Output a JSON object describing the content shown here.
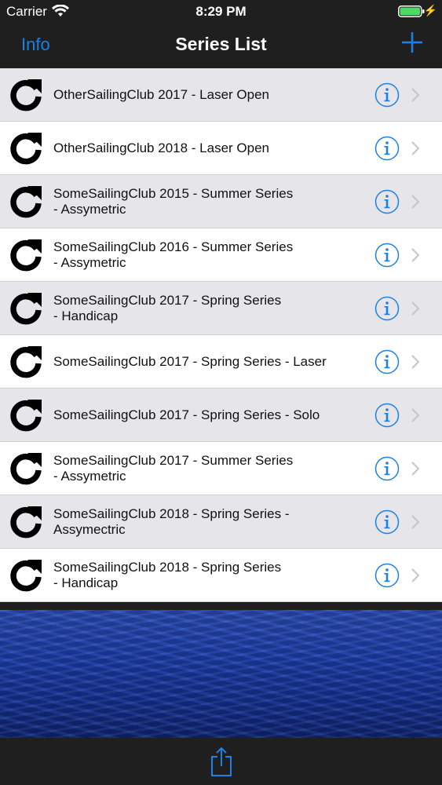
{
  "status": {
    "carrier": "Carrier",
    "time": "8:29 PM"
  },
  "nav": {
    "left_label": "Info",
    "title": "Series List",
    "right_icon": "plus-icon"
  },
  "colors": {
    "accent": "#1a82e6",
    "bar": "#1f1f1f",
    "row_alt": "#e5e5ea",
    "battery": "#4cd964"
  },
  "rows": [
    {
      "line1": "OtherSailingClub 2017 - Laser Open",
      "line2": ""
    },
    {
      "line1": "OtherSailingClub 2018 - Laser Open",
      "line2": ""
    },
    {
      "line1": "SomeSailingClub 2015 - Summer Series",
      "line2": "- Assymetric"
    },
    {
      "line1": "SomeSailingClub 2016 - Summer Series",
      "line2": "- Assymetric"
    },
    {
      "line1": "SomeSailingClub 2017 - Spring Series",
      "line2": "- Handicap"
    },
    {
      "line1": "SomeSailingClub 2017 - Spring Series - Laser",
      "line2": ""
    },
    {
      "line1": "SomeSailingClub 2017 - Spring Series - Solo",
      "line2": ""
    },
    {
      "line1": "SomeSailingClub 2017 - Summer Series",
      "line2": "- Assymetric"
    },
    {
      "line1": "SomeSailingClub 2018 - Spring Series -",
      "line2": "Assymectric"
    },
    {
      "line1": "SomeSailingClub 2018 - Spring Series",
      "line2": "- Handicap"
    }
  ],
  "row_icons": {
    "leading": "refresh-arrow-icon",
    "info": "info-circle-icon",
    "disclosure": "chevron-right-icon"
  },
  "toolbar": {
    "share_icon": "share-icon"
  }
}
